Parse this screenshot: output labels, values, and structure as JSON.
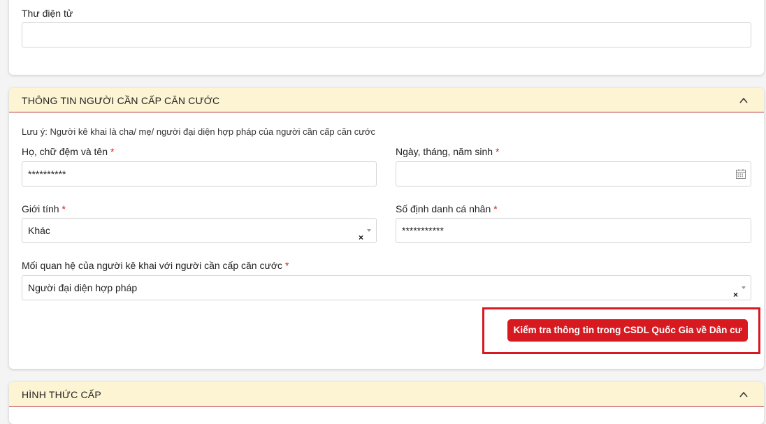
{
  "email_section": {
    "label": "Thư điện tử",
    "value": ""
  },
  "applicant_section": {
    "title": "THÔNG TIN NGƯỜI CẦN CẤP CĂN CƯỚC",
    "note": "Lưu ý: Người kê khai là cha/ mẹ/ người đại diện hợp pháp của người cần cấp căn cước",
    "full_name": {
      "label": "Họ, chữ đệm và tên",
      "required": "*",
      "value": "**********"
    },
    "dob": {
      "label": "Ngày, tháng, năm sinh",
      "required": "*",
      "value": ""
    },
    "gender": {
      "label": "Giới tính",
      "required": "*",
      "value": "Khác",
      "clear": "×"
    },
    "personal_id": {
      "label": "Số định danh cá nhân",
      "required": "*",
      "value": "***********"
    },
    "relationship": {
      "label": "Mối quan hệ của người kê khai với người cần cấp căn cước",
      "required": "*",
      "value": "Người đại diện hợp pháp",
      "clear": "×"
    },
    "check_button": "Kiểm tra thông tin trong CSDL Quốc Gia về Dân cư"
  },
  "method_section": {
    "title": "HÌNH THỨC CẤP"
  },
  "colors": {
    "accent": "#d71920",
    "header_bg": "#fdf4d3",
    "header_border": "#b5312f"
  },
  "icons": [
    "chevron-up-icon",
    "calendar-icon",
    "clear-icon",
    "caret-down-icon"
  ]
}
